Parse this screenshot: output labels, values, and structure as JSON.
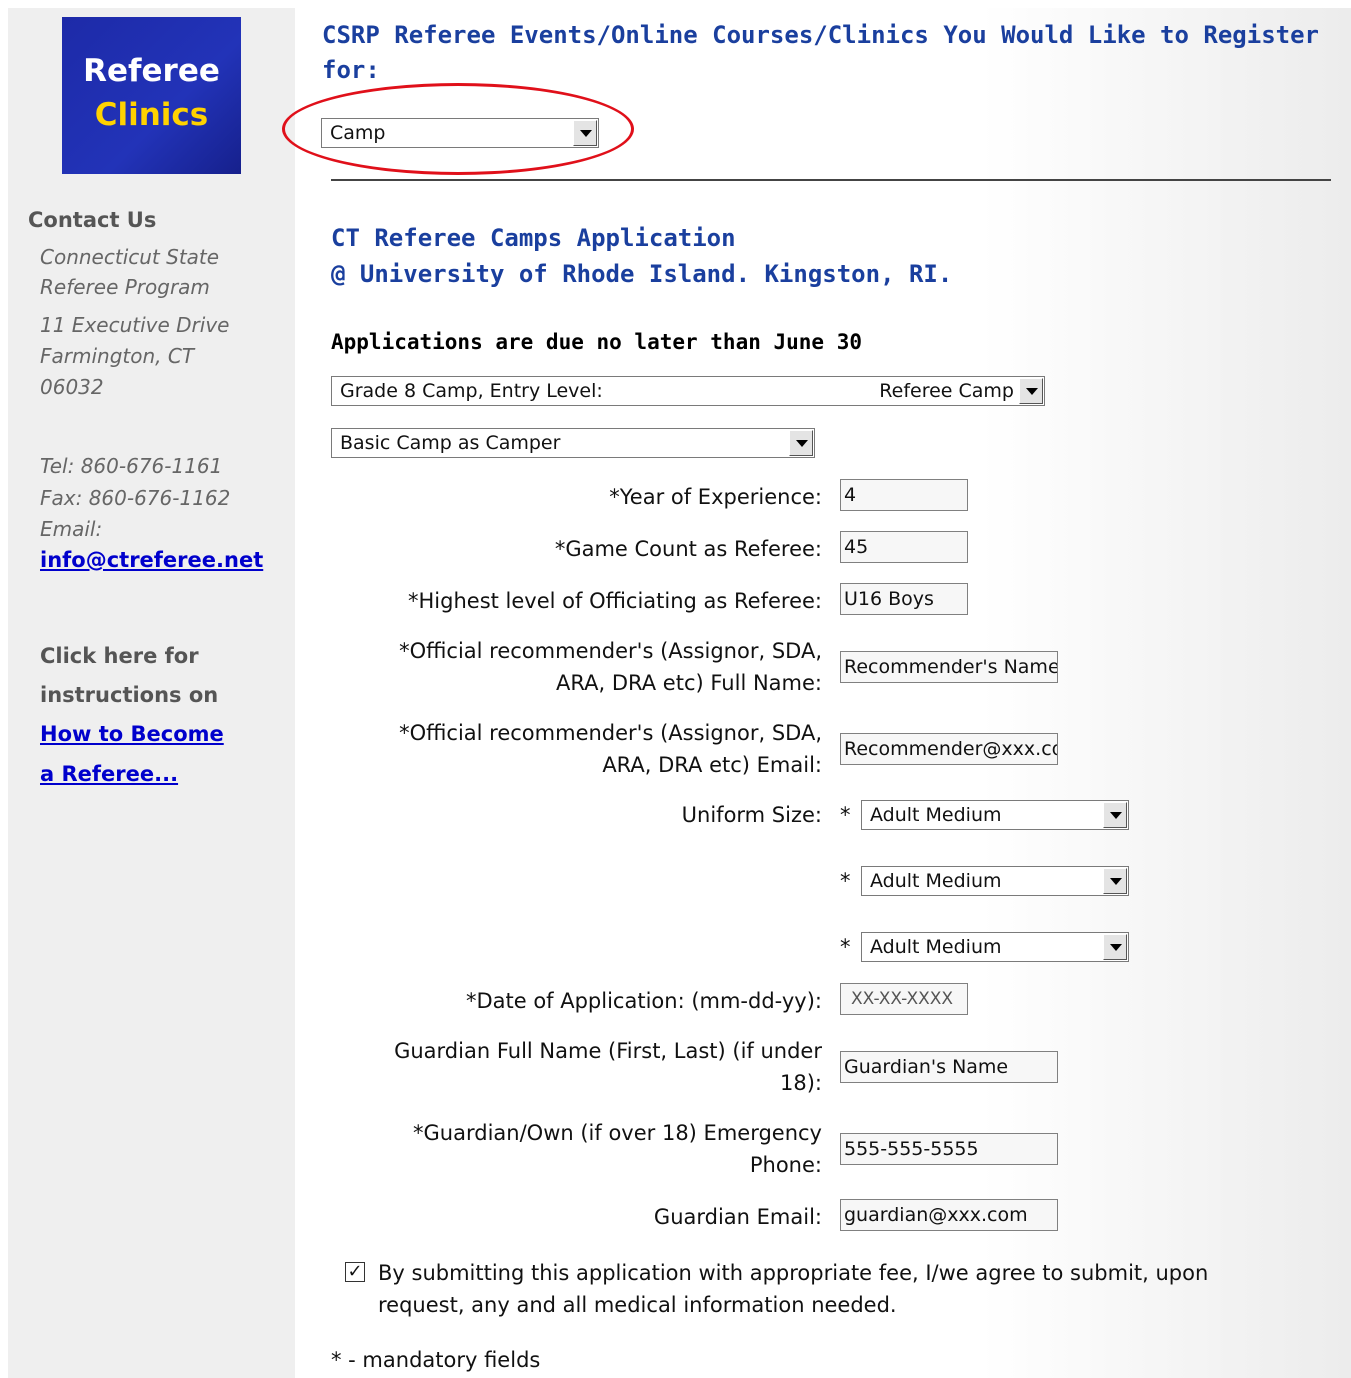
{
  "sidebar": {
    "logo": {
      "line1": "Referee",
      "line2": "Clinics"
    },
    "contact_heading": "Contact Us",
    "org_line1": "Connecticut State",
    "org_line2": "Referee Program",
    "addr_line1": "11 Executive Drive",
    "addr_line2": "Farmington, CT",
    "addr_line3": "06032",
    "tel": "Tel: 860-676-1161",
    "fax": "Fax: 860-676-1162",
    "email_label": "Email:",
    "email": "info@ctreferee.net",
    "instr_line1": "Click here for",
    "instr_line2": "instructions on",
    "link_line1": "How to Become",
    "link_line2": "a Referee..."
  },
  "main": {
    "heading_line1": "CSRP Referee Events/Online Courses/Clinics You Would Like to Register",
    "heading_line2": "for:",
    "event_select": "Camp",
    "app_title_line1": "CT Referee Camps Application",
    "app_title_line2": "@ University of Rhode Island. Kingston, RI.",
    "due_notice": "Applications are due no later than June 30",
    "camp_select_left": "Grade 8 Camp, Entry Level:",
    "camp_select_right": "Referee Camp",
    "type_select": "Basic Camp as Camper"
  },
  "form": {
    "years_label": "*Year of Experience:",
    "years_value": "4",
    "games_label": "*Game Count as Referee:",
    "games_value": "45",
    "level_label": "*Highest level of Officiating as Referee:",
    "level_value": "U16 Boys",
    "rec_name_label1": "*Official recommender's (Assignor, SDA,",
    "rec_name_label2": "ARA, DRA etc) Full Name:",
    "rec_name_value": "Recommender's Name",
    "rec_email_label1": "*Official recommender's (Assignor, SDA,",
    "rec_email_label2": "ARA, DRA etc) Email:",
    "rec_email_value": "Recommender@xxx.com",
    "uniform_label": "Uniform Size:",
    "star": "*",
    "uniform1": "Adult Medium",
    "uniform2": "Adult Medium",
    "uniform3": "Adult Medium",
    "date_label": "*Date of Application: (mm-dd-yy):",
    "date_value": "XX-XX-XXXX",
    "guardian_name_label1": "Guardian Full Name (First, Last) (if under",
    "guardian_name_label2": "18):",
    "guardian_name_value": "Guardian's Name",
    "emergency_label1": "*Guardian/Own (if over 18) Emergency",
    "emergency_label2": "Phone:",
    "emergency_value": "555-555-5555",
    "guardian_email_label": "Guardian Email:",
    "guardian_email_value": "guardian@xxx.com",
    "agree_check": "✓",
    "agree_line1": "By submitting this application with appropriate fee, I/we agree to submit, upon",
    "agree_line2": "request, any and all medical information needed.",
    "mandatory_note": "* - mandatory fields"
  },
  "colors": {
    "heading_blue": "#1a3f9e",
    "link_blue": "#0000cc",
    "highlight_red": "#e0101a",
    "logo_blue": "#2233b8",
    "logo_yellow": "#ffd200"
  }
}
